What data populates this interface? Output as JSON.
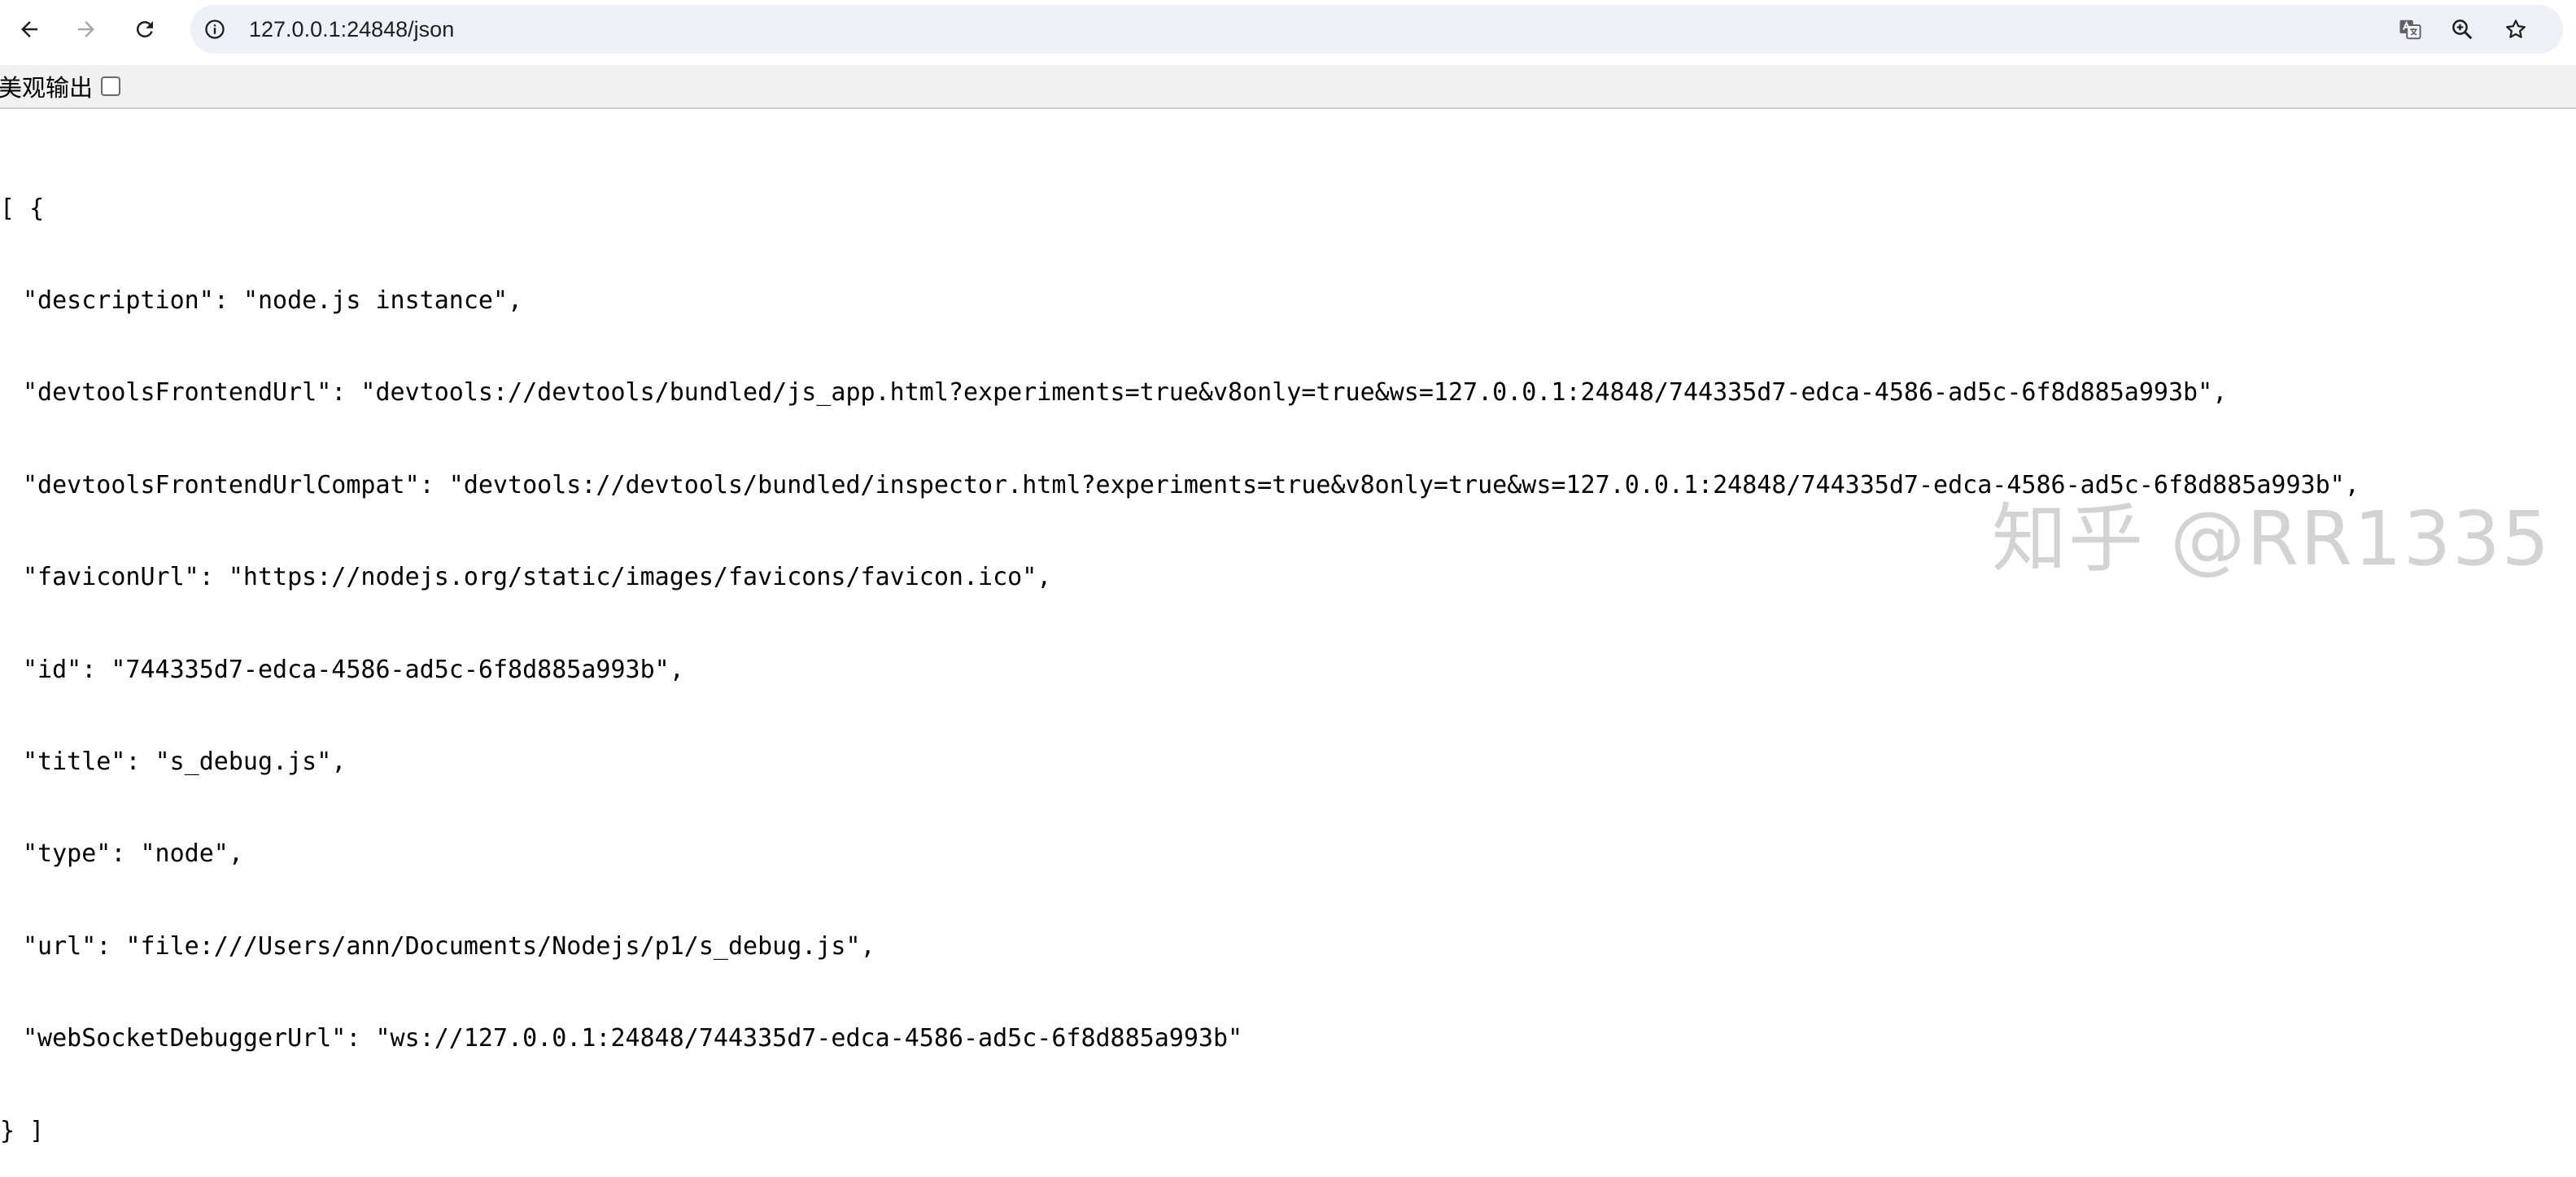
{
  "browser": {
    "url": "127.0.0.1:24848/json"
  },
  "pretty_print": {
    "label": "美观输出",
    "checked": false
  },
  "json": {
    "open": "[ {",
    "close": "} ]",
    "entries": [
      {
        "key": "\"description\"",
        "value": "\"node.js instance\"",
        "comma": ","
      },
      {
        "key": "\"devtoolsFrontendUrl\"",
        "value": "\"devtools://devtools/bundled/js_app.html?experiments=true&v8only=true&ws=127.0.0.1:24848/744335d7-edca-4586-ad5c-6f8d885a993b\"",
        "comma": ","
      },
      {
        "key": "\"devtoolsFrontendUrlCompat\"",
        "value": "\"devtools://devtools/bundled/inspector.html?experiments=true&v8only=true&ws=127.0.0.1:24848/744335d7-edca-4586-ad5c-6f8d885a993b\"",
        "comma": ","
      },
      {
        "key": "\"faviconUrl\"",
        "value": "\"https://nodejs.org/static/images/favicons/favicon.ico\"",
        "comma": ","
      },
      {
        "key": "\"id\"",
        "value": "\"744335d7-edca-4586-ad5c-6f8d885a993b\"",
        "comma": ","
      },
      {
        "key": "\"title\"",
        "value": "\"s_debug.js\"",
        "comma": ","
      },
      {
        "key": "\"type\"",
        "value": "\"node\"",
        "comma": ","
      },
      {
        "key": "\"url\"",
        "value": "\"file:///Users/ann/Documents/Nodejs/p1/s_debug.js\"",
        "comma": ","
      },
      {
        "key": "\"webSocketDebuggerUrl\"",
        "value": "\"ws://127.0.0.1:24848/744335d7-edca-4586-ad5c-6f8d885a993b\"",
        "comma": ""
      }
    ]
  },
  "watermark": "知乎 @RR1335"
}
